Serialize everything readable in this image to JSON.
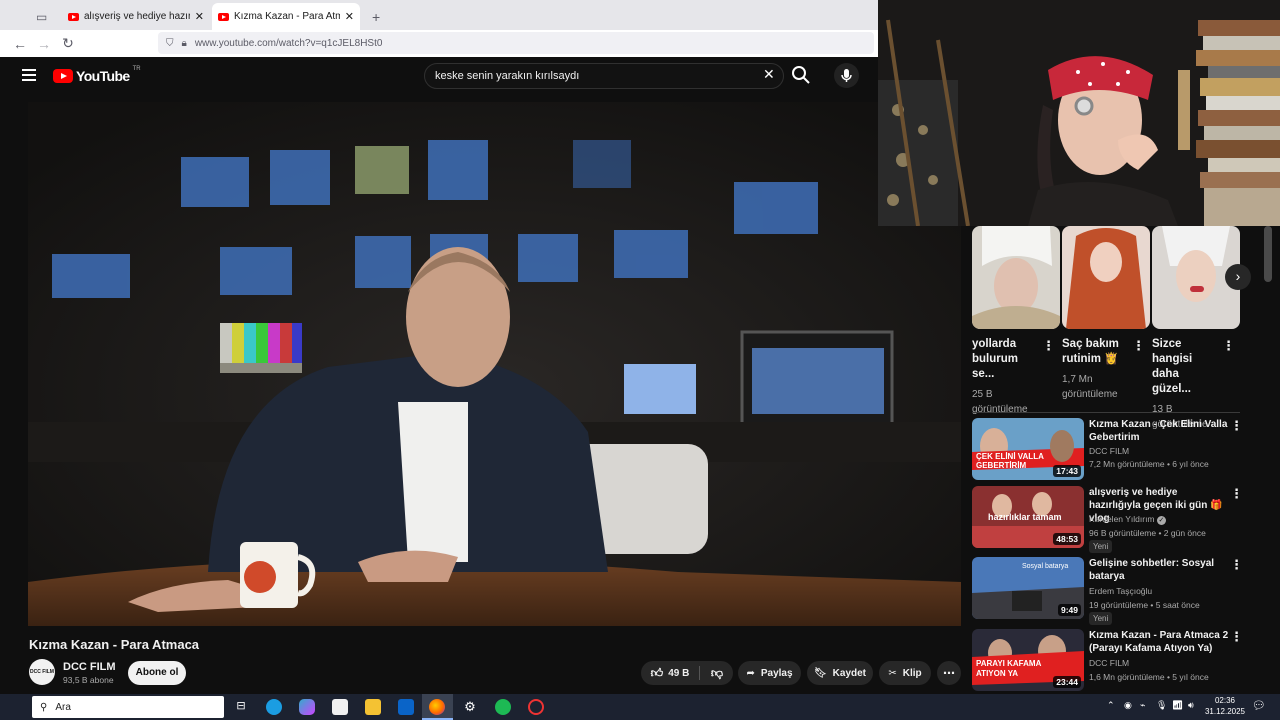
{
  "browser": {
    "tabs": [
      {
        "title": "alışveriş ve hediye hazırlığıyla g"
      },
      {
        "title": "Kızma Kazan - Para Atmaca - Yo"
      }
    ],
    "url": "www.youtube.com/watch?v=q1cJEL8HSt0"
  },
  "youtube": {
    "logo": "YouTube",
    "region": "TR",
    "search_value": "keske senin yarakın kırılsaydı"
  },
  "video": {
    "title": "Kızma Kazan - Para Atmaca",
    "channel": "DCC FILM",
    "channel_logo": "DCC FILM",
    "subscribers": "93,5 B abone",
    "subscribe_label": "Abone ol",
    "likes": "49 B",
    "share_label": "Paylaş",
    "save_label": "Kaydet",
    "clip_label": "Klip"
  },
  "shorts": [
    {
      "title": "yollarda bulurum se...",
      "views": "25 B görüntüleme"
    },
    {
      "title": "Saç bakım rutinim 👸",
      "views": "1,7 Mn görüntüleme"
    },
    {
      "title": "Sizce hangisi daha güzel...",
      "views": "13 B görüntüleme"
    }
  ],
  "recommendations": [
    {
      "title": "Kızma Kazan - Çek Elini Valla Gebertirim",
      "channel": "DCC FILM",
      "meta": "7,2 Mn görüntüleme • 6 yıl önce",
      "duration": "17:43",
      "thumb_text": "ÇEK ELİNİ VALLA GEBERTİRİM",
      "badge": ""
    },
    {
      "title": "alışveriş ve hediye hazırlığıyla geçen iki gün 🎁 vlog",
      "channel": "Kardelen Yıldırım",
      "meta": "96 B görüntüleme • 2 gün önce",
      "duration": "48:53",
      "thumb_text": "hazırlıklar tamam",
      "badge": "Yeni"
    },
    {
      "title": "Gelişine sohbetler: Sosyal batarya",
      "channel": "Erdem Taşçıoğlu",
      "meta": "19 görüntüleme • 5 saat önce",
      "duration": "9:49",
      "thumb_text": "Sosyal batarya",
      "badge": "Yeni"
    },
    {
      "title": "Kızma Kazan - Para Atmaca 2 (Parayı Kafama Atıyon Ya)",
      "channel": "DCC FILM",
      "meta": "1,6 Mn görüntüleme • 5 yıl önce",
      "duration": "23:44",
      "thumb_text": "PARAYI KAFAMA ATIYON YA",
      "badge": ""
    }
  ],
  "taskbar": {
    "search_placeholder": "Ara",
    "time": "02:36",
    "date": "31.12.2025"
  }
}
